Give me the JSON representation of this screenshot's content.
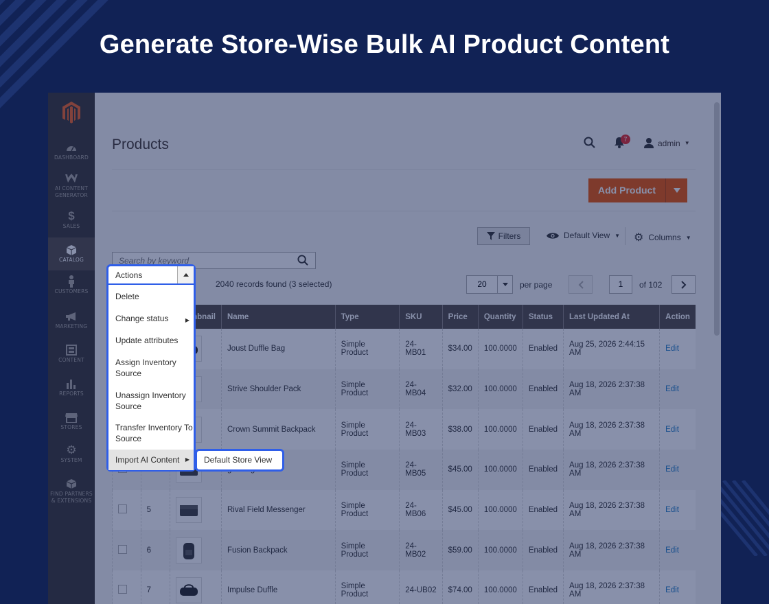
{
  "headline": "Generate Store-Wise Bulk AI Product Content",
  "sidebar": {
    "items": [
      {
        "label": "DASHBOARD",
        "icon": "dashboard-icon"
      },
      {
        "label": "AI CONTENT GENERATOR",
        "icon": "ai-content-generator-icon"
      },
      {
        "label": "SALES",
        "icon": "dollar-icon"
      },
      {
        "label": "CATALOG",
        "icon": "box-icon",
        "active": true
      },
      {
        "label": "CUSTOMERS",
        "icon": "person-icon"
      },
      {
        "label": "MARKETING",
        "icon": "megaphone-icon"
      },
      {
        "label": "CONTENT",
        "icon": "content-icon"
      },
      {
        "label": "REPORTS",
        "icon": "bar-chart-icon"
      },
      {
        "label": "STORES",
        "icon": "store-icon"
      },
      {
        "label": "SYSTEM",
        "icon": "gear-icon"
      },
      {
        "label": "FIND PARTNERS & EXTENSIONS",
        "icon": "extensions-box-icon"
      }
    ]
  },
  "header": {
    "page_title": "Products",
    "notification_count": "7",
    "user": "admin"
  },
  "toolbar": {
    "add_product": "Add Product",
    "filters": "Filters",
    "default_view": "Default View",
    "columns": "Columns",
    "search_placeholder": "Search by keyword"
  },
  "grid_info": {
    "records": "2040 records found (3 selected)",
    "per_page_value": "20",
    "per_page_label": "per page",
    "current_page": "1",
    "of_pages": "of 102"
  },
  "columns": [
    "Thumbnail",
    "Name",
    "Type",
    "SKU",
    "Price",
    "Quantity",
    "Status",
    "Last Updated At",
    "Action"
  ],
  "rows": [
    {
      "id": "",
      "name": "Joust Duffle Bag",
      "type": "Simple Product",
      "sku": "24-MB01",
      "price": "$34.00",
      "qty": "100.0000",
      "status": "Enabled",
      "updated": "Aug 25, 2026 2:44:15 AM",
      "action": "Edit"
    },
    {
      "id": "",
      "name": "Strive Shoulder Pack",
      "type": "Simple Product",
      "sku": "24-MB04",
      "price": "$32.00",
      "qty": "100.0000",
      "status": "Enabled",
      "updated": "Aug 18, 2026 2:37:38 AM",
      "action": "Edit"
    },
    {
      "id": "",
      "name": "Crown Summit Backpack",
      "type": "Simple Product",
      "sku": "24-MB03",
      "price": "$38.00",
      "qty": "100.0000",
      "status": "Enabled",
      "updated": "Aug 18, 2026 2:37:38 AM",
      "action": "Edit"
    },
    {
      "id": "",
      "name": "ger Bag",
      "type": "Simple Product",
      "sku": "24-MB05",
      "price": "$45.00",
      "qty": "100.0000",
      "status": "Enabled",
      "updated": "Aug 18, 2026 2:37:38 AM",
      "action": "Edit"
    },
    {
      "id": "5",
      "name": "Rival Field Messenger",
      "type": "Simple Product",
      "sku": "24-MB06",
      "price": "$45.00",
      "qty": "100.0000",
      "status": "Enabled",
      "updated": "Aug 18, 2026 2:37:38 AM",
      "action": "Edit"
    },
    {
      "id": "6",
      "name": "Fusion Backpack",
      "type": "Simple Product",
      "sku": "24-MB02",
      "price": "$59.00",
      "qty": "100.0000",
      "status": "Enabled",
      "updated": "Aug 18, 2026 2:37:38 AM",
      "action": "Edit"
    },
    {
      "id": "7",
      "name": "Impulse Duffle",
      "type": "Simple Product",
      "sku": "24-UB02",
      "price": "$74.00",
      "qty": "100.0000",
      "status": "Enabled",
      "updated": "Aug 18, 2026 2:37:38 AM",
      "action": "Edit"
    }
  ],
  "actions_menu": {
    "label": "Actions",
    "items": [
      {
        "label": "Delete",
        "submenu": false
      },
      {
        "label": "Change status",
        "submenu": true
      },
      {
        "label": "Update attributes",
        "submenu": false
      },
      {
        "label": "Assign Inventory Source",
        "submenu": false
      },
      {
        "label": "Unassign Inventory Source",
        "submenu": false
      },
      {
        "label": "Transfer Inventory To Source",
        "submenu": false
      },
      {
        "label": "Import AI Content",
        "submenu": true
      }
    ],
    "submenu_item": "Default Store View"
  },
  "colors": {
    "background": "#112255",
    "accent_orange": "#eb5202",
    "highlight_blue": "#2f5ee8",
    "grid_header": "#514943"
  }
}
